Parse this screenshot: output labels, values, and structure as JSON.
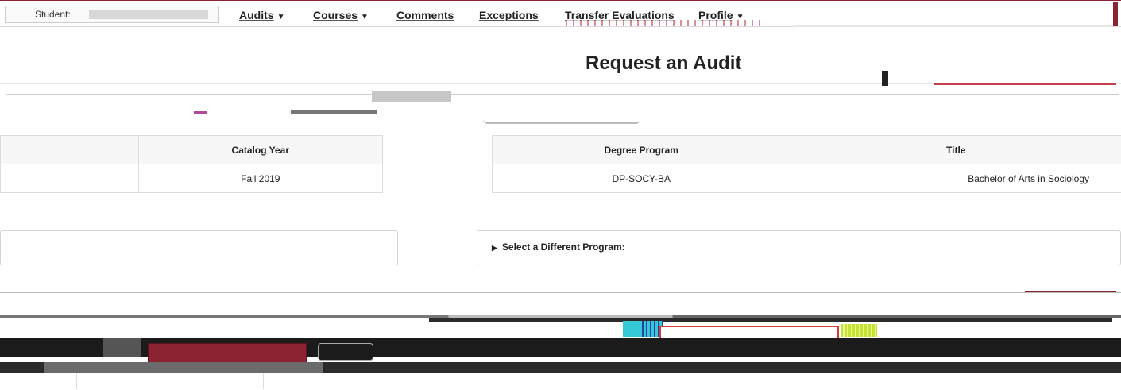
{
  "topnav": {
    "student_label": "Student:",
    "links": [
      {
        "label": "Audits",
        "dropdown": true
      },
      {
        "label": "Courses",
        "dropdown": true
      },
      {
        "label": "Comments",
        "dropdown": false
      },
      {
        "label": "Exceptions",
        "dropdown": false
      },
      {
        "label": "Transfer Evaluations",
        "dropdown": false
      },
      {
        "label": "Profile",
        "dropdown": true
      }
    ],
    "caret_icon": "caret-down-icon"
  },
  "header": {
    "page_title": "Request an Audit"
  },
  "catalog_table": {
    "headers": [
      "",
      "Catalog Year"
    ],
    "rows": [
      [
        "",
        "Fall 2019"
      ]
    ]
  },
  "program_table": {
    "headers": [
      "Degree Program",
      "Title"
    ],
    "rows": [
      [
        "DP-SOCY-BA",
        "Bachelor of Arts in Sociology"
      ]
    ]
  },
  "select_program": {
    "label": "Select a Different Program:",
    "icon": "caret-right-icon"
  },
  "colors": {
    "brand": "#8c2332",
    "border": "#dcdcdc",
    "header_bg": "#f7f7f7"
  }
}
